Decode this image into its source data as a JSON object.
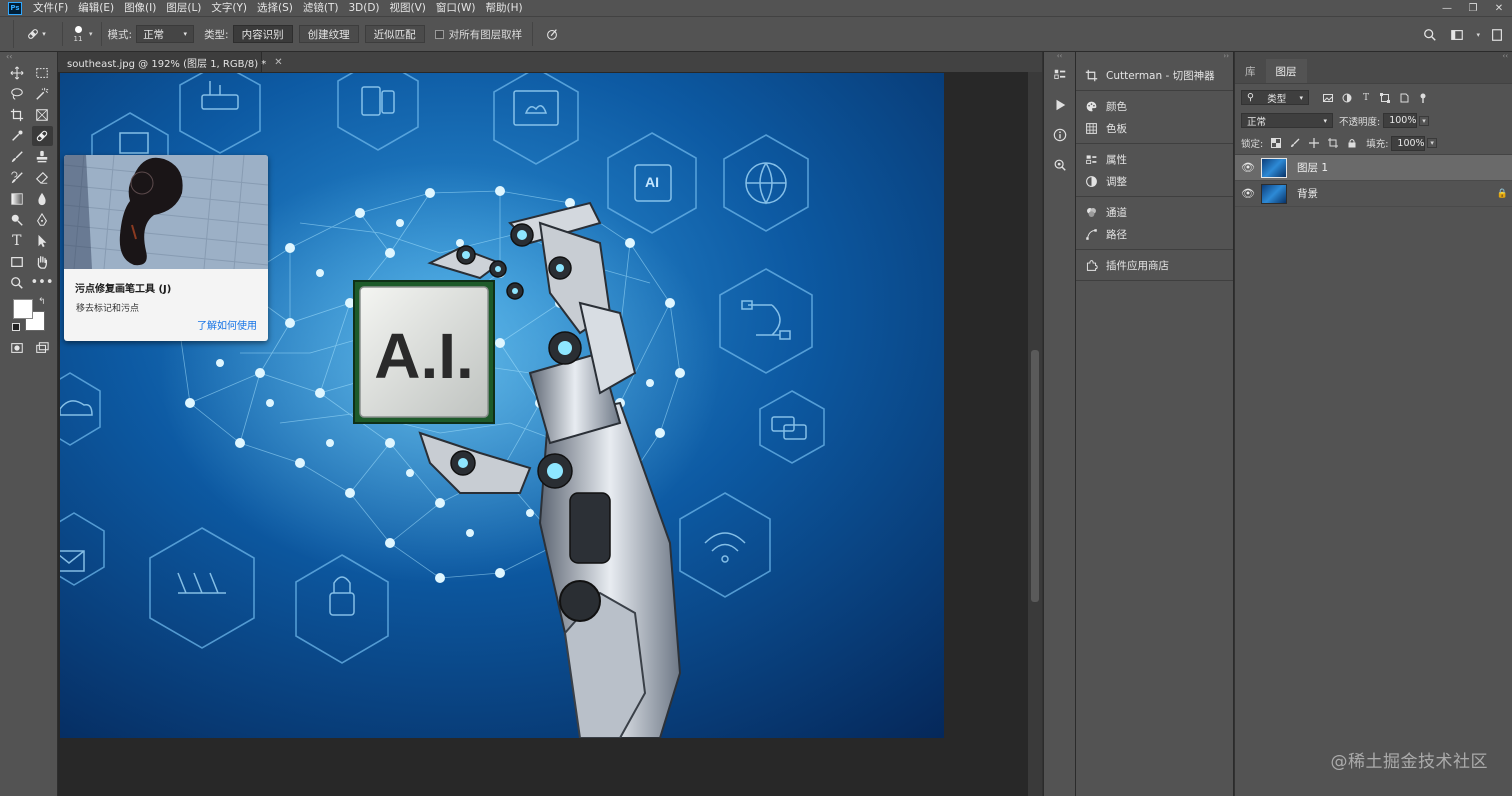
{
  "app": {
    "logo": "Ps",
    "menus": [
      "文件(F)",
      "编辑(E)",
      "图像(I)",
      "图层(L)",
      "文字(Y)",
      "选择(S)",
      "滤镜(T)",
      "3D(D)",
      "视图(V)",
      "窗口(W)",
      "帮助(H)"
    ],
    "window_controls": {
      "minimize": "—",
      "restore": "❐",
      "close": "✕"
    }
  },
  "options_bar": {
    "brush_size": "11",
    "mode_label": "模式:",
    "mode_value": "正常",
    "type_label": "类型:",
    "type_buttons": [
      "内容识别",
      "创建纹理",
      "近似匹配"
    ],
    "sample_all_layers_label": "对所有图层取样"
  },
  "document": {
    "tab_title": "southeast.jpg @ 192% (图层 1, RGB/8) *",
    "chip_text": "A.I.",
    "hex_ai_text": "AI"
  },
  "tooltip": {
    "title": "污点修复画笔工具 (J)",
    "description": "移去标记和污点",
    "link": "了解如何使用"
  },
  "panels": {
    "groups": [
      [
        {
          "label": "Cutterman - 切图神器",
          "icon": "crop-icon"
        }
      ],
      [
        {
          "label": "颜色",
          "icon": "palette-icon"
        },
        {
          "label": "色板",
          "icon": "grid-icon"
        }
      ],
      [
        {
          "label": "属性",
          "icon": "properties-icon"
        },
        {
          "label": "调整",
          "icon": "adjust-icon"
        }
      ],
      [
        {
          "label": "通道",
          "icon": "channels-icon"
        },
        {
          "label": "路径",
          "icon": "paths-icon"
        }
      ],
      [
        {
          "label": "插件应用商店",
          "icon": "puzzle-icon"
        }
      ]
    ]
  },
  "layers_panel": {
    "tabs": [
      "库",
      "图层"
    ],
    "active_tab": "图层",
    "filter_label": "类型",
    "blend_mode": "正常",
    "opacity_label": "不透明度:",
    "opacity_value": "100%",
    "lock_label": "锁定:",
    "fill_label": "填充:",
    "fill_value": "100%",
    "layers": [
      {
        "name": "图层 1",
        "selected": true,
        "locked": false
      },
      {
        "name": "背景",
        "selected": false,
        "locked": true
      }
    ]
  },
  "watermark": "@稀土掘金技术社区",
  "colors": {
    "ui_dark": "#535353",
    "canvas_bg": "#282828",
    "accent_link": "#1473e6",
    "image_blue": "#0a4a8c"
  }
}
